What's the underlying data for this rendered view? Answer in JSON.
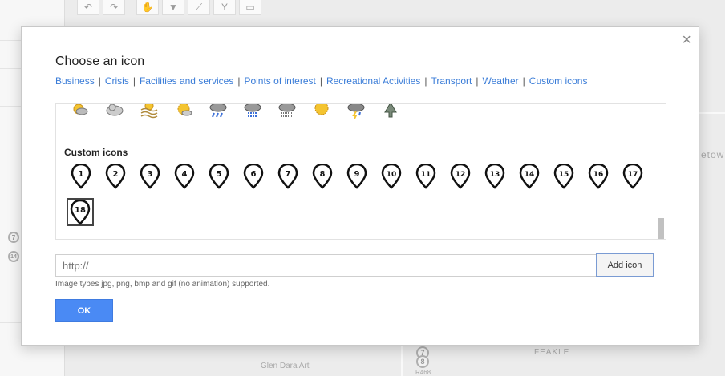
{
  "dialog": {
    "title": "Choose an icon",
    "close_glyph": "×",
    "categories": [
      "Business",
      "Crisis",
      "Facilities and services",
      "Points of interest",
      "Recreational Activities",
      "Transport",
      "Weather",
      "Custom icons"
    ],
    "separator": "|",
    "weather_icons": [
      "sun-cloud-icon",
      "cloud-icon",
      "fog-sun-icon",
      "sun-icon",
      "rain-cloud-icon",
      "sleet-cloud-icon",
      "hail-cloud-icon",
      "sunny-icon",
      "thunderstorm-icon",
      "tree-icon"
    ],
    "custom_section_label": "Custom icons",
    "custom_icons": [
      "1",
      "2",
      "3",
      "4",
      "5",
      "6",
      "7",
      "8",
      "9",
      "10",
      "11",
      "12",
      "13",
      "14",
      "15",
      "16",
      "17"
    ],
    "selected_custom_icon": "18",
    "url_placeholder": "http://",
    "add_icon_label": "Add icon",
    "hint": "Image types jpg, png, bmp and gif (no animation) supported.",
    "ok_label": "OK"
  },
  "map": {
    "labels": [
      "Glen Dara Art",
      "FEAKLE",
      "R468",
      "etow"
    ],
    "pins": [
      "7",
      "14",
      "7",
      "8"
    ]
  },
  "colors": {
    "link": "#3b7dd8",
    "primary_button": "#4a8af4"
  }
}
